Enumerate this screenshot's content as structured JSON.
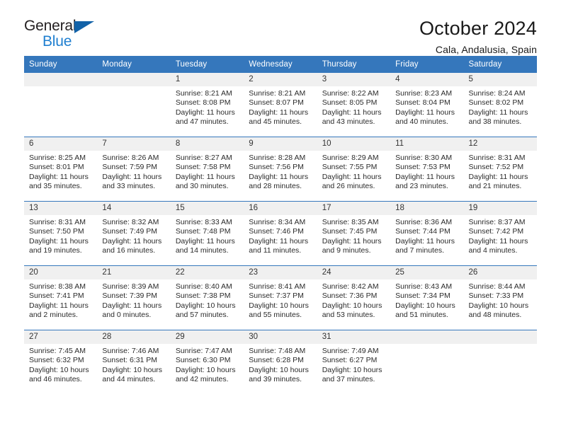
{
  "brand": {
    "name_part1": "General",
    "name_part2": "Blue",
    "accent_color": "#1f7fd0",
    "triangle_color": "#1262a8"
  },
  "header": {
    "title": "October 2024",
    "subtitle": "Cala, Andalusia, Spain"
  },
  "calendar": {
    "header_bg": "#3577bc",
    "daynum_bg": "#f0f0f0",
    "weekday_headers": [
      "Sunday",
      "Monday",
      "Tuesday",
      "Wednesday",
      "Thursday",
      "Friday",
      "Saturday"
    ],
    "weeks": [
      [
        {
          "day": "",
          "sunrise": "",
          "sunset": "",
          "daylight_1": "",
          "daylight_2": ""
        },
        {
          "day": "",
          "sunrise": "",
          "sunset": "",
          "daylight_1": "",
          "daylight_2": ""
        },
        {
          "day": "1",
          "sunrise": "Sunrise: 8:21 AM",
          "sunset": "Sunset: 8:08 PM",
          "daylight_1": "Daylight: 11 hours",
          "daylight_2": "and 47 minutes."
        },
        {
          "day": "2",
          "sunrise": "Sunrise: 8:21 AM",
          "sunset": "Sunset: 8:07 PM",
          "daylight_1": "Daylight: 11 hours",
          "daylight_2": "and 45 minutes."
        },
        {
          "day": "3",
          "sunrise": "Sunrise: 8:22 AM",
          "sunset": "Sunset: 8:05 PM",
          "daylight_1": "Daylight: 11 hours",
          "daylight_2": "and 43 minutes."
        },
        {
          "day": "4",
          "sunrise": "Sunrise: 8:23 AM",
          "sunset": "Sunset: 8:04 PM",
          "daylight_1": "Daylight: 11 hours",
          "daylight_2": "and 40 minutes."
        },
        {
          "day": "5",
          "sunrise": "Sunrise: 8:24 AM",
          "sunset": "Sunset: 8:02 PM",
          "daylight_1": "Daylight: 11 hours",
          "daylight_2": "and 38 minutes."
        }
      ],
      [
        {
          "day": "6",
          "sunrise": "Sunrise: 8:25 AM",
          "sunset": "Sunset: 8:01 PM",
          "daylight_1": "Daylight: 11 hours",
          "daylight_2": "and 35 minutes."
        },
        {
          "day": "7",
          "sunrise": "Sunrise: 8:26 AM",
          "sunset": "Sunset: 7:59 PM",
          "daylight_1": "Daylight: 11 hours",
          "daylight_2": "and 33 minutes."
        },
        {
          "day": "8",
          "sunrise": "Sunrise: 8:27 AM",
          "sunset": "Sunset: 7:58 PM",
          "daylight_1": "Daylight: 11 hours",
          "daylight_2": "and 30 minutes."
        },
        {
          "day": "9",
          "sunrise": "Sunrise: 8:28 AM",
          "sunset": "Sunset: 7:56 PM",
          "daylight_1": "Daylight: 11 hours",
          "daylight_2": "and 28 minutes."
        },
        {
          "day": "10",
          "sunrise": "Sunrise: 8:29 AM",
          "sunset": "Sunset: 7:55 PM",
          "daylight_1": "Daylight: 11 hours",
          "daylight_2": "and 26 minutes."
        },
        {
          "day": "11",
          "sunrise": "Sunrise: 8:30 AM",
          "sunset": "Sunset: 7:53 PM",
          "daylight_1": "Daylight: 11 hours",
          "daylight_2": "and 23 minutes."
        },
        {
          "day": "12",
          "sunrise": "Sunrise: 8:31 AM",
          "sunset": "Sunset: 7:52 PM",
          "daylight_1": "Daylight: 11 hours",
          "daylight_2": "and 21 minutes."
        }
      ],
      [
        {
          "day": "13",
          "sunrise": "Sunrise: 8:31 AM",
          "sunset": "Sunset: 7:50 PM",
          "daylight_1": "Daylight: 11 hours",
          "daylight_2": "and 19 minutes."
        },
        {
          "day": "14",
          "sunrise": "Sunrise: 8:32 AM",
          "sunset": "Sunset: 7:49 PM",
          "daylight_1": "Daylight: 11 hours",
          "daylight_2": "and 16 minutes."
        },
        {
          "day": "15",
          "sunrise": "Sunrise: 8:33 AM",
          "sunset": "Sunset: 7:48 PM",
          "daylight_1": "Daylight: 11 hours",
          "daylight_2": "and 14 minutes."
        },
        {
          "day": "16",
          "sunrise": "Sunrise: 8:34 AM",
          "sunset": "Sunset: 7:46 PM",
          "daylight_1": "Daylight: 11 hours",
          "daylight_2": "and 11 minutes."
        },
        {
          "day": "17",
          "sunrise": "Sunrise: 8:35 AM",
          "sunset": "Sunset: 7:45 PM",
          "daylight_1": "Daylight: 11 hours",
          "daylight_2": "and 9 minutes."
        },
        {
          "day": "18",
          "sunrise": "Sunrise: 8:36 AM",
          "sunset": "Sunset: 7:44 PM",
          "daylight_1": "Daylight: 11 hours",
          "daylight_2": "and 7 minutes."
        },
        {
          "day": "19",
          "sunrise": "Sunrise: 8:37 AM",
          "sunset": "Sunset: 7:42 PM",
          "daylight_1": "Daylight: 11 hours",
          "daylight_2": "and 4 minutes."
        }
      ],
      [
        {
          "day": "20",
          "sunrise": "Sunrise: 8:38 AM",
          "sunset": "Sunset: 7:41 PM",
          "daylight_1": "Daylight: 11 hours",
          "daylight_2": "and 2 minutes."
        },
        {
          "day": "21",
          "sunrise": "Sunrise: 8:39 AM",
          "sunset": "Sunset: 7:39 PM",
          "daylight_1": "Daylight: 11 hours",
          "daylight_2": "and 0 minutes."
        },
        {
          "day": "22",
          "sunrise": "Sunrise: 8:40 AM",
          "sunset": "Sunset: 7:38 PM",
          "daylight_1": "Daylight: 10 hours",
          "daylight_2": "and 57 minutes."
        },
        {
          "day": "23",
          "sunrise": "Sunrise: 8:41 AM",
          "sunset": "Sunset: 7:37 PM",
          "daylight_1": "Daylight: 10 hours",
          "daylight_2": "and 55 minutes."
        },
        {
          "day": "24",
          "sunrise": "Sunrise: 8:42 AM",
          "sunset": "Sunset: 7:36 PM",
          "daylight_1": "Daylight: 10 hours",
          "daylight_2": "and 53 minutes."
        },
        {
          "day": "25",
          "sunrise": "Sunrise: 8:43 AM",
          "sunset": "Sunset: 7:34 PM",
          "daylight_1": "Daylight: 10 hours",
          "daylight_2": "and 51 minutes."
        },
        {
          "day": "26",
          "sunrise": "Sunrise: 8:44 AM",
          "sunset": "Sunset: 7:33 PM",
          "daylight_1": "Daylight: 10 hours",
          "daylight_2": "and 48 minutes."
        }
      ],
      [
        {
          "day": "27",
          "sunrise": "Sunrise: 7:45 AM",
          "sunset": "Sunset: 6:32 PM",
          "daylight_1": "Daylight: 10 hours",
          "daylight_2": "and 46 minutes."
        },
        {
          "day": "28",
          "sunrise": "Sunrise: 7:46 AM",
          "sunset": "Sunset: 6:31 PM",
          "daylight_1": "Daylight: 10 hours",
          "daylight_2": "and 44 minutes."
        },
        {
          "day": "29",
          "sunrise": "Sunrise: 7:47 AM",
          "sunset": "Sunset: 6:30 PM",
          "daylight_1": "Daylight: 10 hours",
          "daylight_2": "and 42 minutes."
        },
        {
          "day": "30",
          "sunrise": "Sunrise: 7:48 AM",
          "sunset": "Sunset: 6:28 PM",
          "daylight_1": "Daylight: 10 hours",
          "daylight_2": "and 39 minutes."
        },
        {
          "day": "31",
          "sunrise": "Sunrise: 7:49 AM",
          "sunset": "Sunset: 6:27 PM",
          "daylight_1": "Daylight: 10 hours",
          "daylight_2": "and 37 minutes."
        },
        {
          "day": "",
          "sunrise": "",
          "sunset": "",
          "daylight_1": "",
          "daylight_2": ""
        },
        {
          "day": "",
          "sunrise": "",
          "sunset": "",
          "daylight_1": "",
          "daylight_2": ""
        }
      ]
    ]
  }
}
